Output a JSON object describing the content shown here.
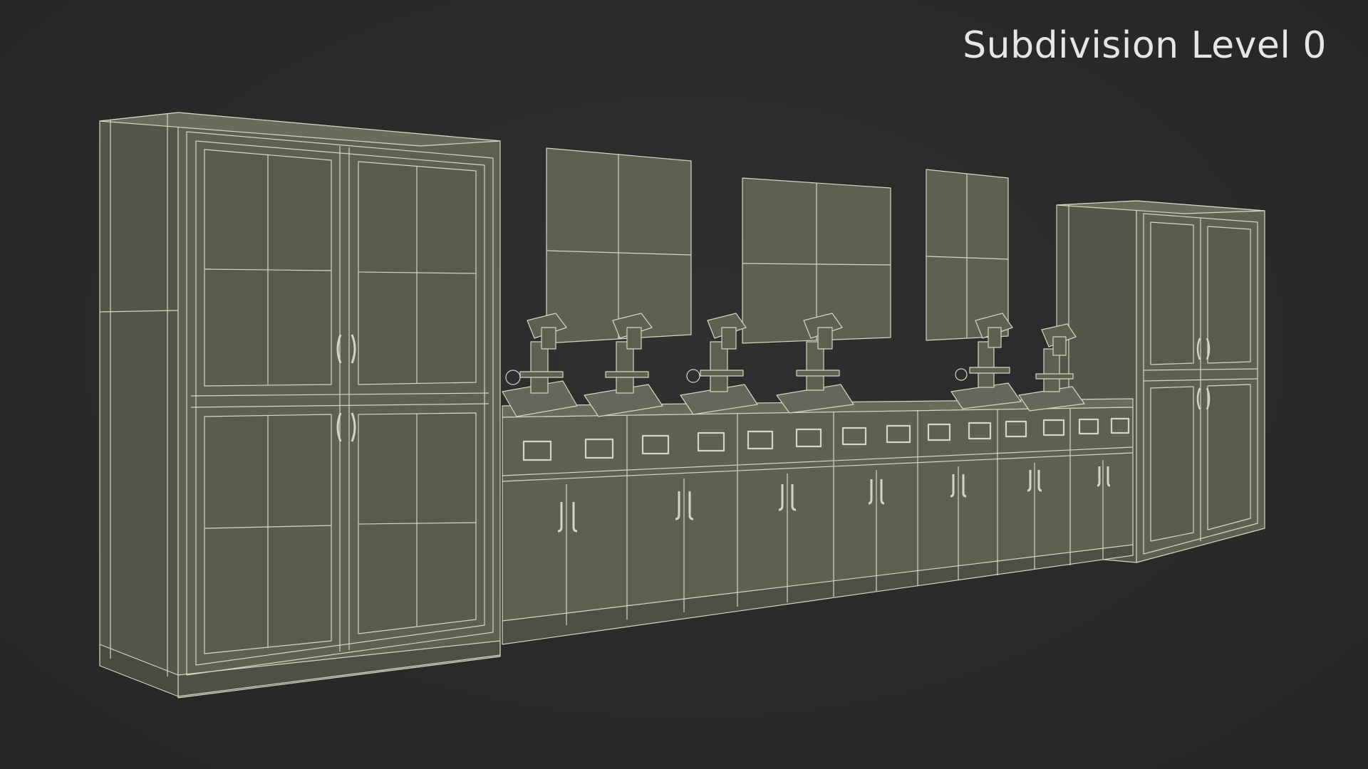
{
  "viewport": {
    "label": "Subdivision Level 0",
    "background_color": "#2b2b2b"
  },
  "model": {
    "surface_color": "#5f604f",
    "wire_color": "#d4d5c2",
    "objects": [
      "tall-cabinet",
      "monitor",
      "microscope",
      "lab-bench-cabinet",
      "drawer-handle",
      "door-handle"
    ]
  }
}
